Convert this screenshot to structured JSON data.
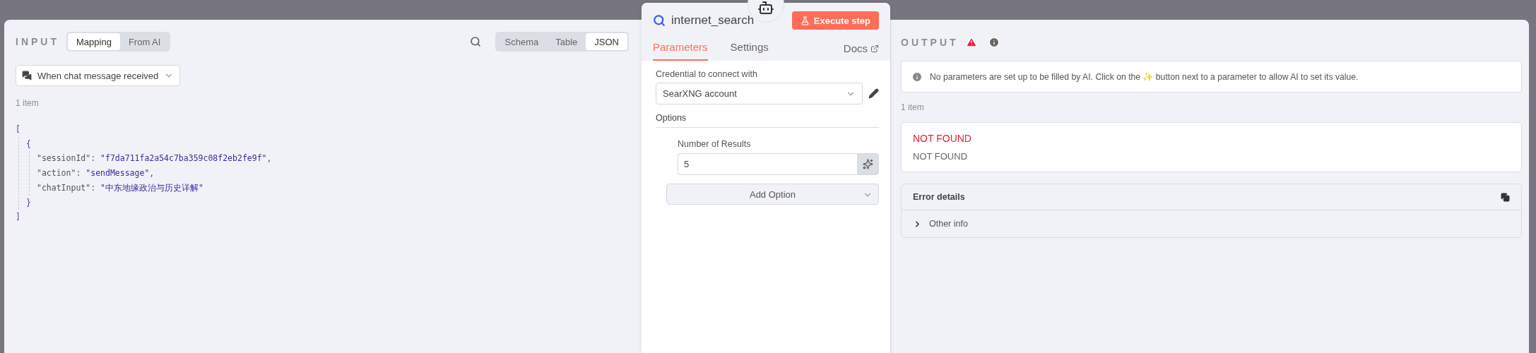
{
  "input": {
    "title": "INPUT",
    "modes": [
      {
        "label": "Mapping",
        "selected": true
      },
      {
        "label": "From AI",
        "selected": false
      }
    ],
    "views": [
      {
        "label": "Schema",
        "selected": false
      },
      {
        "label": "Table",
        "selected": false
      },
      {
        "label": "JSON",
        "selected": true
      }
    ],
    "trigger": "When chat message received",
    "item_count": "1 item",
    "json": {
      "open": "[",
      "close": "]",
      "children": [
        {
          "open": "{",
          "close": "}",
          "pairs": [
            {
              "key": "\"sessionId\":",
              "value": "\"f7da711fa2a54c7ba359c08f2eb2fe9f\"",
              "comma": ","
            },
            {
              "key": "\"action\":",
              "value": "\"sendMessage\"",
              "comma": ","
            },
            {
              "key": "\"chatInput\":",
              "value": "\"中东地缘政治与历史详解\""
            }
          ]
        }
      ]
    }
  },
  "node": {
    "title": "internet_search",
    "execute": "Execute step",
    "tabs": [
      {
        "label": "Parameters",
        "selected": true
      },
      {
        "label": "Settings",
        "selected": false
      }
    ],
    "docs": "Docs",
    "credential_label": "Credential to connect with",
    "credential": "SearXNG account",
    "options_label": "Options",
    "field_label": "Number of Results",
    "field_value": "5",
    "add_option": "Add Option"
  },
  "output": {
    "title": "OUTPUT",
    "notice": "No parameters are set up to be filled by AI. Click on the ✨ button next to a parameter to allow AI to set its value.",
    "item_count": "1 item",
    "error_title": "NOT FOUND",
    "error_message": "NOT FOUND",
    "details_title": "Error details",
    "sections": [
      {
        "label": "Other info",
        "expanded": false
      }
    ]
  }
}
